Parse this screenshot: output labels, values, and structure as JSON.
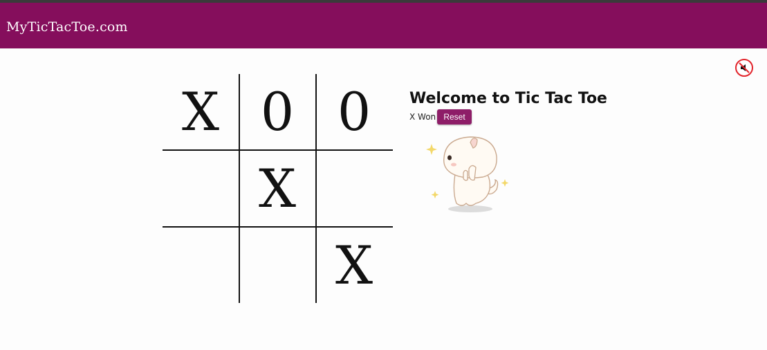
{
  "header": {
    "brand": "MyTicTacToe.com",
    "bar_color": "#850e5c"
  },
  "sound_toggle": {
    "icon": "speaker-muted-icon",
    "state": "muted"
  },
  "game": {
    "title": "Welcome to Tic Tac Toe",
    "status": "X Won",
    "reset_label": "Reset",
    "board": [
      "X",
      "0",
      "0",
      "",
      "X",
      "",
      "",
      "",
      "X"
    ]
  },
  "mascot": {
    "icon": "cat-mascot-icon"
  },
  "colors": {
    "accent": "#850e5c",
    "button": "#8e1d68",
    "mute_ring": "#e2242b"
  }
}
